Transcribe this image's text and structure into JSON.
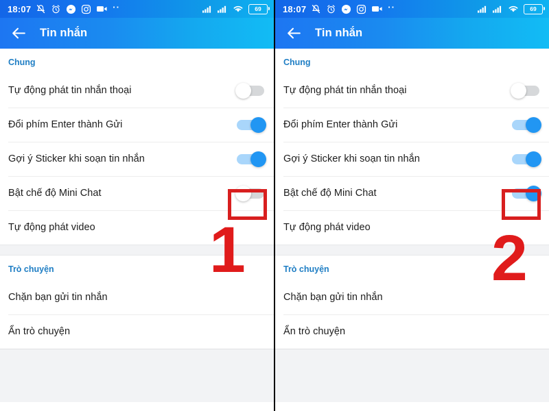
{
  "status_bar": {
    "time": "18:07",
    "battery_level": "69",
    "icons_left": [
      "silent-mode-icon",
      "alarm-clock-icon",
      "messenger-icon",
      "instagram-icon",
      "video-camera-icon"
    ],
    "overflow_dots": "··",
    "icons_right": [
      "signal-bars-sim1-icon",
      "signal-bars-sim2-icon",
      "wifi-icon",
      "battery-icon"
    ]
  },
  "app_bar": {
    "back_icon": "back-arrow-icon",
    "title": "Tin nhắn"
  },
  "sections": {
    "general": {
      "header": "Chung",
      "rows": [
        {
          "label": "Tự động phát tin nhắn thoại",
          "control": "switch",
          "state_left": "off",
          "state_right": "off"
        },
        {
          "label": "Đổi phím Enter thành Gửi",
          "control": "switch",
          "state_left": "on",
          "state_right": "on"
        },
        {
          "label": "Gợi ý Sticker khi soạn tin nhắn",
          "control": "switch",
          "state_left": "on",
          "state_right": "on"
        },
        {
          "label": "Bật chế độ Mini Chat",
          "control": "switch",
          "state_left": "off",
          "state_right": "on"
        },
        {
          "label": "Tự động phát video",
          "control": "none",
          "state_left": "",
          "state_right": ""
        }
      ]
    },
    "chat": {
      "header": "Trò chuyện",
      "rows": [
        {
          "label": "Chặn bạn gửi tin nhắn",
          "control": "none"
        },
        {
          "label": "Ẩn trò chuyện",
          "control": "none"
        }
      ]
    }
  },
  "annotations": {
    "step_one": "1",
    "step_two": "2",
    "highlight_color": "#d81f1f",
    "number_color": "#e01b1b"
  },
  "colors": {
    "accent_blue": "#2196f3",
    "section_header": "#1f7ec4",
    "appbar_gradient_start": "#1d76f2",
    "appbar_gradient_end": "#12bcf5",
    "switch_off_track": "#d6d8da",
    "switch_on_track": "#a9d6fb",
    "page_background": "#ffffff",
    "band_background": "#f2f3f5"
  }
}
